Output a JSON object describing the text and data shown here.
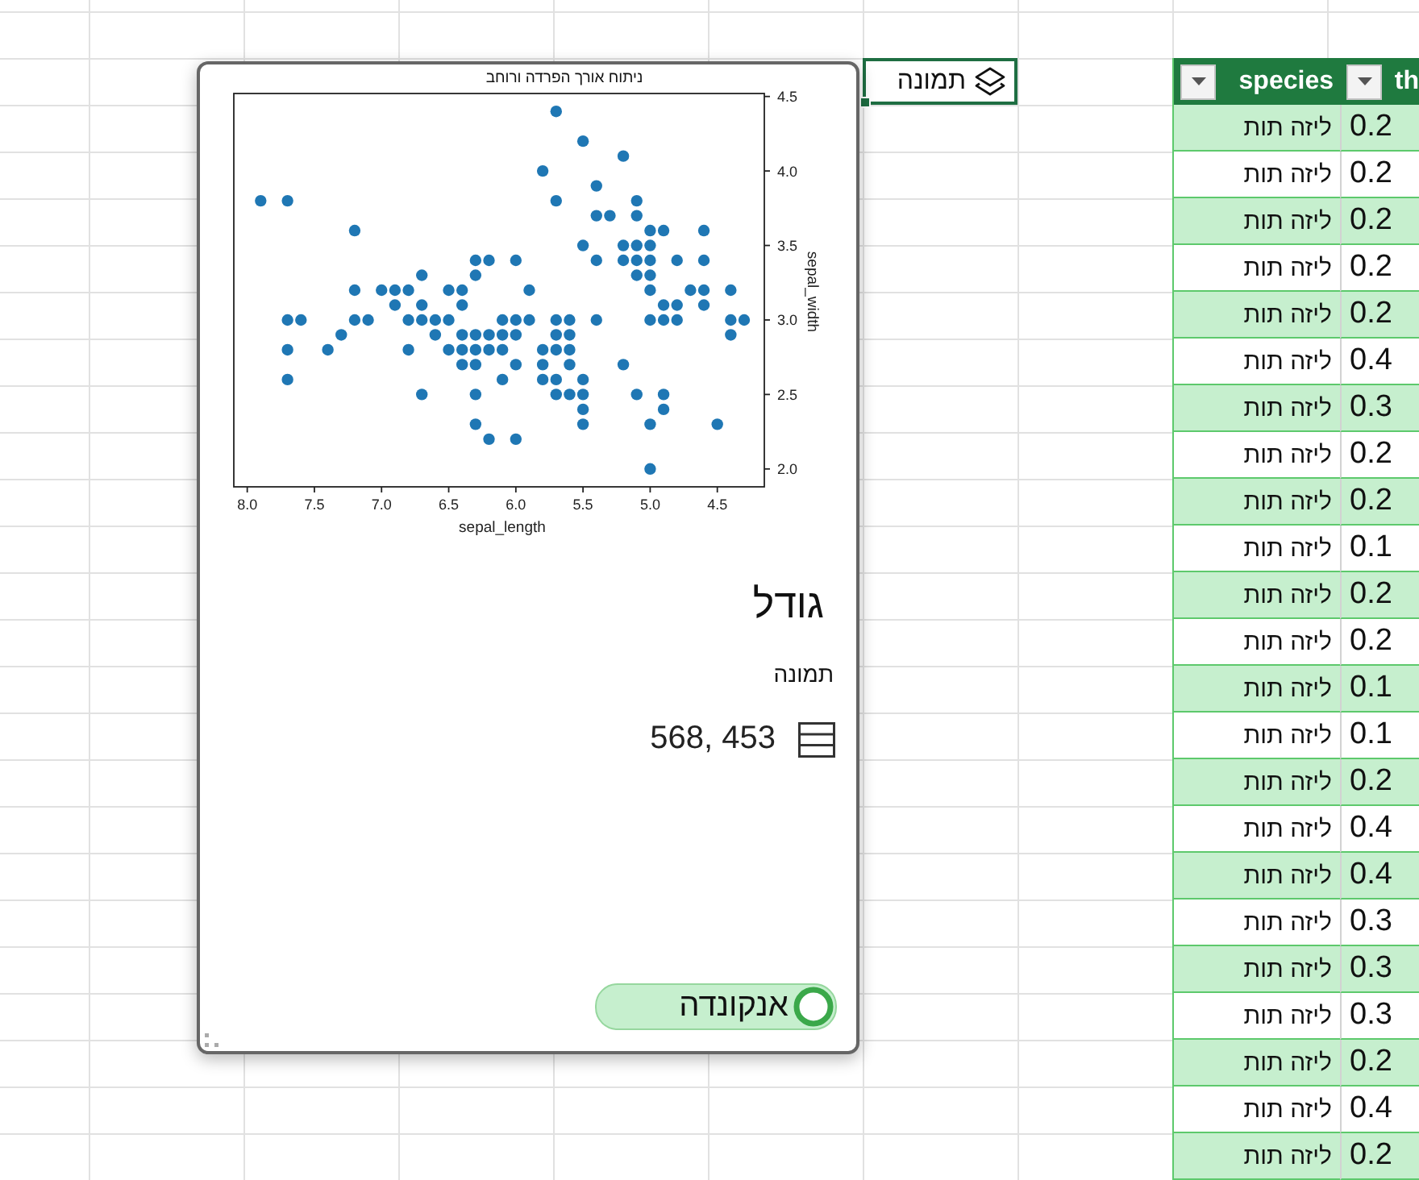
{
  "selected_cell": {
    "text": "תמונה",
    "selected": true
  },
  "card": {
    "chart_data": {
      "type": "scatter",
      "title": "ניתוח אורך הפרדה ורוחב",
      "xlabel": "sepal_length",
      "ylabel": "sepal_width",
      "x": [
        5.1,
        4.9,
        4.7,
        4.6,
        5.0,
        5.4,
        4.6,
        5.0,
        4.4,
        4.9,
        5.4,
        4.8,
        4.8,
        4.3,
        5.8,
        5.7,
        5.7,
        5.1,
        5.4,
        5.1,
        4.6,
        5.1,
        5.0,
        5.2,
        5.2,
        4.8,
        5.2,
        5.5,
        5.0,
        5.5,
        4.9,
        4.4,
        5.1,
        5.0,
        4.5,
        4.4,
        4.6,
        5.3,
        5.0,
        7.0,
        6.4,
        6.9,
        5.5,
        6.5,
        5.7,
        6.3,
        4.9,
        6.6,
        5.2,
        5.0,
        5.9,
        6.0,
        6.1,
        5.6,
        6.7,
        5.6,
        5.8,
        6.2,
        5.6,
        5.9,
        6.1,
        6.3,
        6.4,
        6.6,
        6.8,
        6.7,
        6.0,
        5.7,
        5.5,
        6.0,
        5.4,
        6.0,
        6.3,
        5.5,
        5.5,
        6.1,
        5.8,
        5.0,
        5.6,
        5.7,
        5.7,
        6.2,
        5.1,
        7.1,
        6.3,
        6.5,
        7.6,
        4.9,
        7.3,
        6.7,
        7.2,
        6.5,
        6.4,
        6.8,
        5.7,
        5.8,
        7.7,
        7.7,
        6.9,
        5.6,
        7.7,
        6.3,
        6.7,
        7.2,
        6.2,
        6.4,
        7.2,
        7.4,
        7.9,
        6.3,
        6.1,
        7.7,
        6.3,
        6.4,
        6.0,
        6.8,
        6.2
      ],
      "series": [
        {
          "color": "#1f77b4",
          "values": [
            3.5,
            3.0,
            3.2,
            3.1,
            3.6,
            3.9,
            3.4,
            3.4,
            2.9,
            3.1,
            3.7,
            3.4,
            3.0,
            3.0,
            4.0,
            4.4,
            3.8,
            3.8,
            3.4,
            3.7,
            3.6,
            3.3,
            3.0,
            3.5,
            3.4,
            3.1,
            4.1,
            4.2,
            3.2,
            3.5,
            3.6,
            3.0,
            3.4,
            3.5,
            2.3,
            3.2,
            3.2,
            3.7,
            3.3,
            3.2,
            3.2,
            3.1,
            2.3,
            2.8,
            2.8,
            3.3,
            2.4,
            2.9,
            2.7,
            2.0,
            3.0,
            2.2,
            2.9,
            2.9,
            3.1,
            3.0,
            2.7,
            2.2,
            2.5,
            3.2,
            2.8,
            2.5,
            2.9,
            3.0,
            2.8,
            3.0,
            2.9,
            2.6,
            2.4,
            2.7,
            3.0,
            3.4,
            2.3,
            2.5,
            2.6,
            3.0,
            2.6,
            2.3,
            2.7,
            3.0,
            2.9,
            2.9,
            2.5,
            3.0,
            2.9,
            3.0,
            3.0,
            2.5,
            2.9,
            2.5,
            3.6,
            3.2,
            2.7,
            3.0,
            2.5,
            2.8,
            3.8,
            2.6,
            3.2,
            2.8,
            2.8,
            2.7,
            3.3,
            3.2,
            2.8,
            2.8,
            3.0,
            2.8,
            3.8,
            2.8,
            2.6,
            3.0,
            3.4,
            3.1,
            3.0,
            3.2,
            3.4
          ]
        }
      ],
      "xlim": [
        8.1,
        4.15
      ],
      "ylim": [
        1.88,
        4.52
      ],
      "xticks": [
        {
          "value": 8.0,
          "label": "8.0"
        },
        {
          "value": 7.5,
          "label": "7.5"
        },
        {
          "value": 7.0,
          "label": "7.0"
        },
        {
          "value": 6.5,
          "label": "6.5"
        },
        {
          "value": 6.0,
          "label": "6.0"
        },
        {
          "value": 5.5,
          "label": "5.5"
        },
        {
          "value": 5.0,
          "label": "5.0"
        },
        {
          "value": 4.5,
          "label": "4.5"
        }
      ],
      "yticks": [
        {
          "value": 4.5,
          "label": "4.5"
        },
        {
          "value": 4.0,
          "label": "4.0"
        },
        {
          "value": 3.5,
          "label": "3.5"
        },
        {
          "value": 3.0,
          "label": "3.0"
        },
        {
          "value": 2.5,
          "label": "2.5"
        },
        {
          "value": 2.0,
          "label": "2.0"
        }
      ]
    },
    "title": "גודל",
    "subtitle": "תמונה",
    "dimensions": "568, 453",
    "source_button": {
      "label": "אנקונדה"
    }
  },
  "table": {
    "columns": [
      {
        "label": "th"
      },
      {
        "label": "species"
      }
    ],
    "rows": [
      [
        "0.2",
        "ליזה תות"
      ],
      [
        "0.2",
        "ליזה תות"
      ],
      [
        "0.2",
        "ליזה תות"
      ],
      [
        "0.2",
        "ליזה תות"
      ],
      [
        "0.2",
        "ליזה תות"
      ],
      [
        "0.4",
        "ליזה תות"
      ],
      [
        "0.3",
        "ליזה תות"
      ],
      [
        "0.2",
        "ליזה תות"
      ],
      [
        "0.2",
        "ליזה תות"
      ],
      [
        "0.1",
        "ליזה תות"
      ],
      [
        "0.2",
        "ליזה תות"
      ],
      [
        "0.2",
        "ליזה תות"
      ],
      [
        "0.1",
        "ליזה תות"
      ],
      [
        "0.1",
        "ליזה תות"
      ],
      [
        "0.2",
        "ליזה תות"
      ],
      [
        "0.4",
        "ליזה תות"
      ],
      [
        "0.4",
        "ליזה תות"
      ],
      [
        "0.3",
        "ליזה תות"
      ],
      [
        "0.3",
        "ליזה תות"
      ],
      [
        "0.3",
        "ליזה תות"
      ],
      [
        "0.2",
        "ליזה תות"
      ],
      [
        "0.4",
        "ליזה תות"
      ],
      [
        "0.2",
        "ליזה תות"
      ]
    ]
  }
}
